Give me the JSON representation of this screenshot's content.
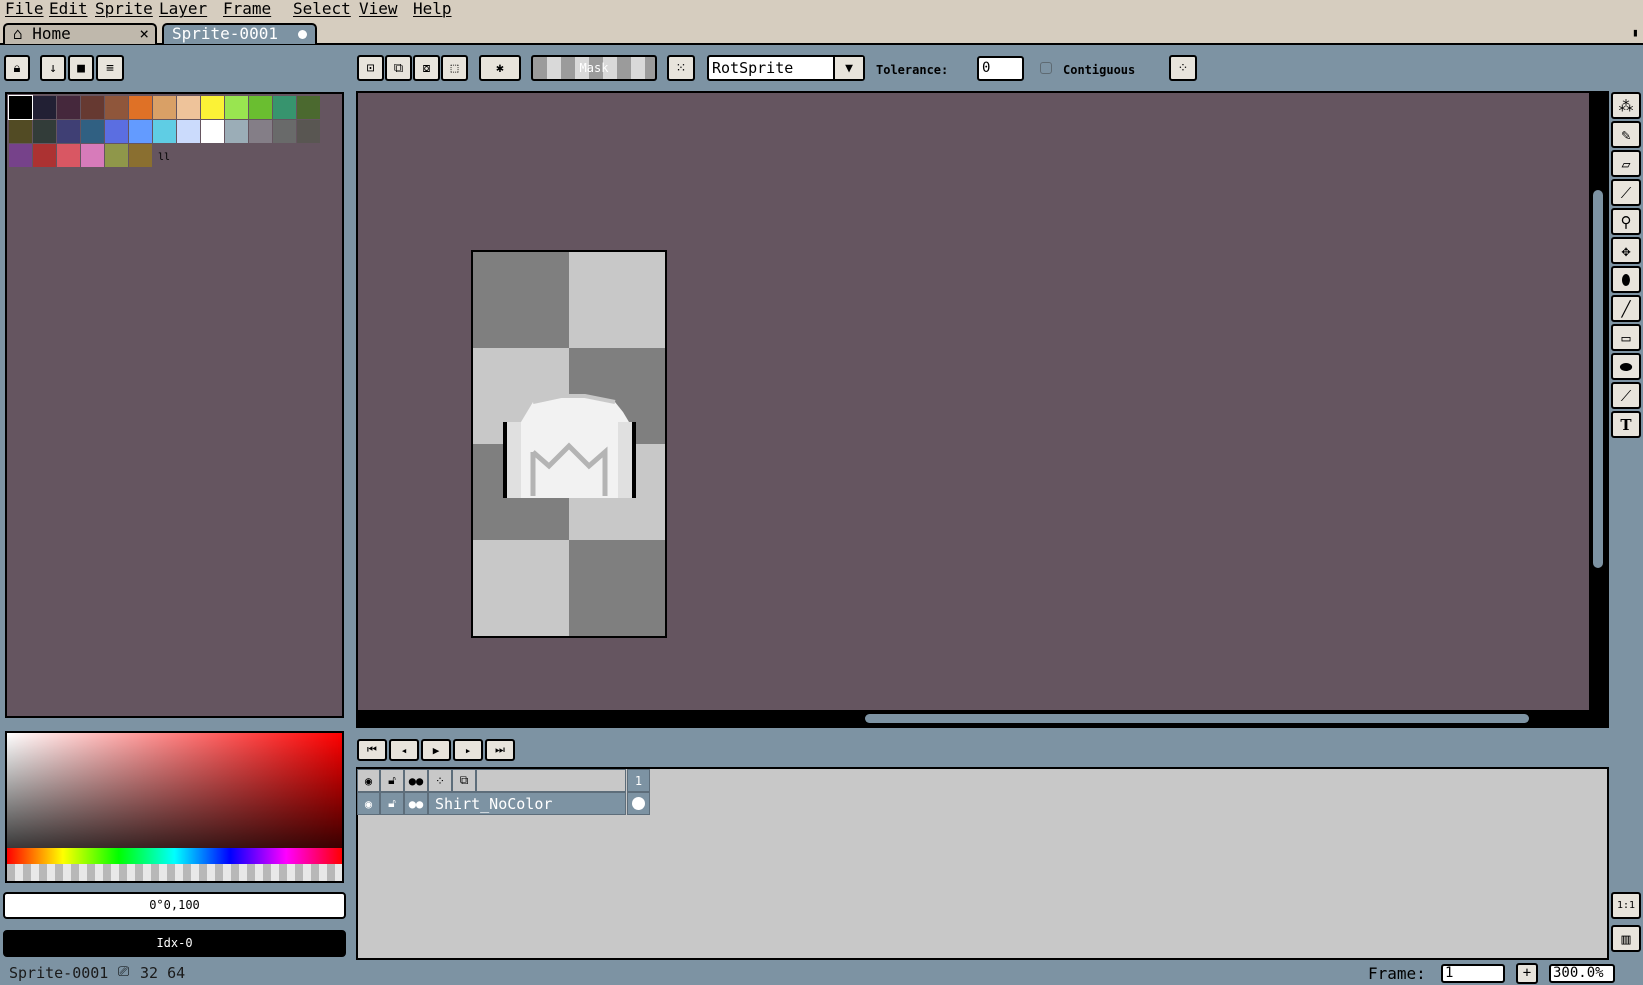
{
  "menu": [
    "File",
    "Edit",
    "Sprite",
    "Layer",
    "Frame",
    "Select",
    "View",
    "Help"
  ],
  "tabs": {
    "home": "Home",
    "home_close": "×",
    "sprite": "Sprite-0001"
  },
  "toolbar": {
    "mask_label": "Mask",
    "rotation_algorithm": "RotSprite",
    "tolerance_label": "Tolerance:",
    "tolerance_value": "0",
    "contiguous_label": "Contiguous"
  },
  "palette": {
    "colors": [
      "#000000",
      "#222034",
      "#45283c",
      "#663931",
      "#8f563b",
      "#df7126",
      "#d9a066",
      "#eec39a",
      "#fbf236",
      "#99e550",
      "#6abe30",
      "#37946e",
      "#4b692f",
      "#524b24",
      "#323c39",
      "#3f3f74",
      "#306082",
      "#5b6ee1",
      "#639bff",
      "#5fcde4",
      "#cbdbfc",
      "#ffffff",
      "#9badb7",
      "#847e87",
      "#696a6a",
      "#595652",
      "#76428a",
      "#ac3232",
      "#d95763",
      "#d77bba",
      "#8f974a",
      "#8a6f30"
    ]
  },
  "color_fields": {
    "hsv": "0°0,100",
    "index": "Idx-0"
  },
  "timeline": {
    "frame_header": "1",
    "layers": [
      {
        "name": "Shirt_NoColor"
      }
    ]
  },
  "status": {
    "sprite_name": "Sprite-0001",
    "size": "32 64",
    "frame_label": "Frame:",
    "frame_value": "1",
    "zoom": "300.0%"
  },
  "colors": {
    "canvas_bg": "#655560",
    "ui_bg": "#7d93a3",
    "menu_bg": "#d6cdbf"
  }
}
